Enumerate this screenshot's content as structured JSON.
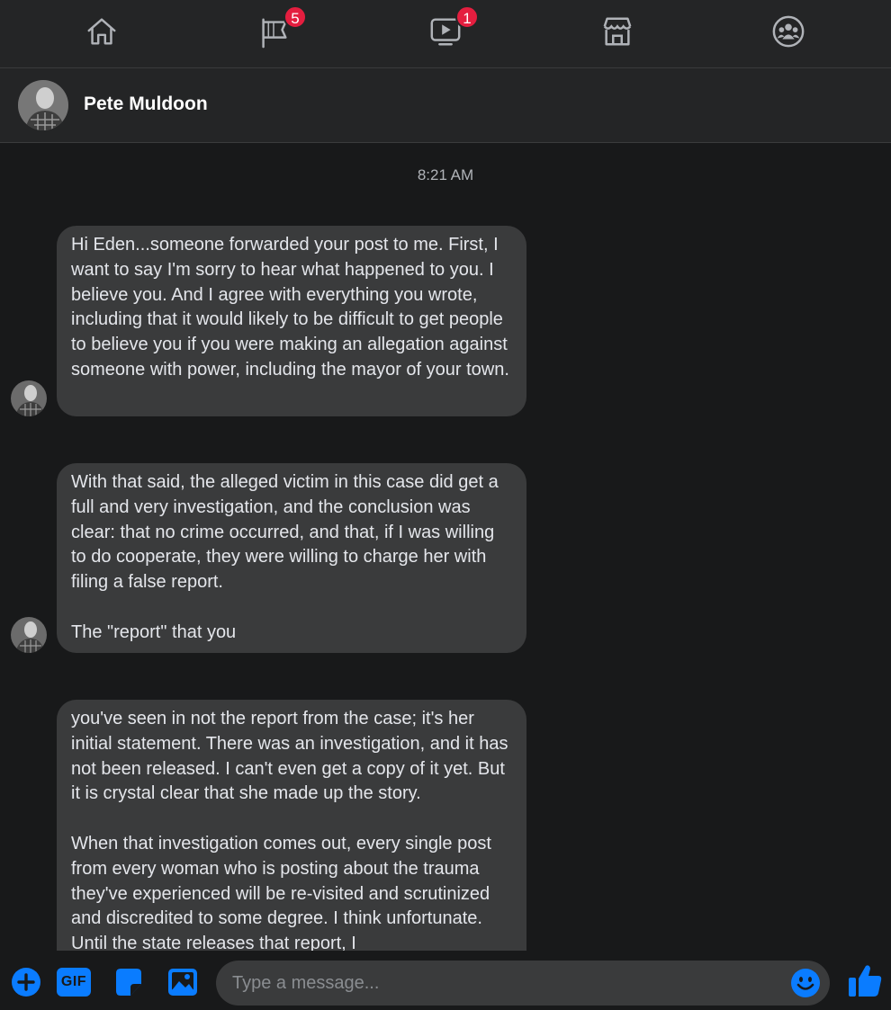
{
  "topnav": {
    "items": [
      {
        "name": "home",
        "badge": ""
      },
      {
        "name": "pages",
        "badge": "5"
      },
      {
        "name": "watch",
        "badge": "1"
      },
      {
        "name": "marketplace",
        "badge": ""
      },
      {
        "name": "groups",
        "badge": ""
      }
    ]
  },
  "header": {
    "contact_name": "Pete Muldoon"
  },
  "conversation": {
    "timestamp": "8:21 AM",
    "messages": [
      {
        "text": "Hi Eden...someone forwarded your post to me. First, I want to say I'm sorry to hear what happened to you. I believe you. And I agree with everything you wrote, including that it would likely to be difficult to get people to believe you if you were making an allegation against someone with power, including the mayor of your town."
      },
      {
        "text": "With that said, the alleged victim in this case did get a full and very investigation, and the conclusion was clear: that no crime occurred, and that, if I was willing to do cooperate, they were willing to charge her with filing a false report.\n\nThe \"report\" that you"
      },
      {
        "text": "you've seen in not the report from the case; it's her initial statement. There was an investigation, and it has not been released. I can't even get a copy of it yet. But it is crystal clear that she made up the story.\n\nWhen that investigation comes out, every single post from every woman who is posting about the trauma they've experienced will be re-visited and scrutinized and discredited to some degree. I think unfortunate. Until the state releases that report, I"
      }
    ]
  },
  "composer": {
    "gif_label": "GIF",
    "placeholder": "Type a message..."
  },
  "colors": {
    "accent": "#0a7cff",
    "badge": "#e41e3f",
    "bubble": "#3a3b3c",
    "background": "#18191a",
    "bar": "#242526"
  }
}
